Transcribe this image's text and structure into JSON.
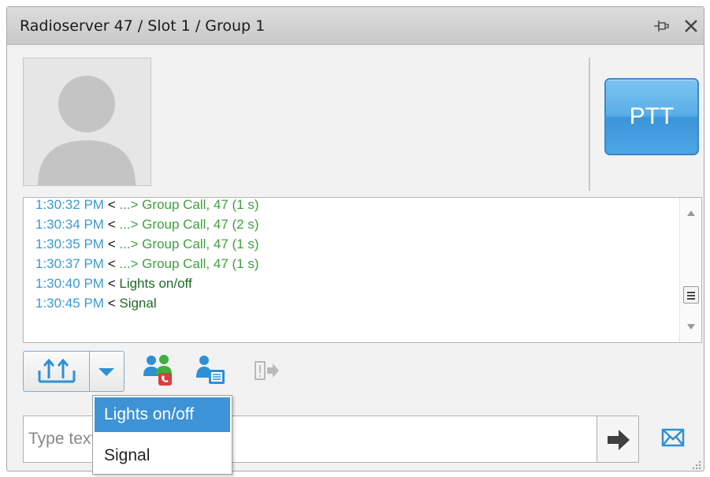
{
  "window": {
    "title": "Radioserver 47 / Slot 1 / Group 1",
    "pin_icon": "pin-icon",
    "close_icon": "close-icon"
  },
  "contact": {
    "avatar_icon": "default-user-avatar",
    "ptt_label": "PTT"
  },
  "log": {
    "entries": [
      {
        "time": "1:30:32 PM",
        "dir": "<",
        "message": "...> Group Call, 47 (1 s)",
        "kind": "call"
      },
      {
        "time": "1:30:34 PM",
        "dir": "<",
        "message": "...> Group Call, 47 (2 s)",
        "kind": "call"
      },
      {
        "time": "1:30:35 PM",
        "dir": "<",
        "message": "...> Group Call, 47 (1 s)",
        "kind": "call"
      },
      {
        "time": "1:30:37 PM",
        "dir": "<",
        "message": "...> Group Call, 47 (1 s)",
        "kind": "call"
      },
      {
        "time": "1:30:40 PM",
        "dir": "<",
        "message": "Lights on/off",
        "kind": "status"
      },
      {
        "time": "1:30:45 PM",
        "dir": "<",
        "message": "Signal",
        "kind": "status"
      }
    ]
  },
  "toolbar": {
    "send_status_icon": "send-status-icon",
    "dropdown_icon": "chevron-down-icon",
    "call_icon": "group-call-icon",
    "phone_icon": "phone-call-icon",
    "remote_icon": "remote-monitor-icon"
  },
  "status_menu": {
    "items": [
      {
        "label": "Lights on/off",
        "selected": true
      },
      {
        "label": "Signal",
        "selected": false
      }
    ]
  },
  "composer": {
    "placeholder": "Type text and press Enter",
    "value": "",
    "send_icon": "arrow-right-icon",
    "mail_icon": "envelope-icon"
  },
  "colors": {
    "timestamp": "#3a9ad6",
    "call_message": "#3fa03f",
    "status_message": "#1d6b25",
    "accent": "#3d93d6",
    "ptt": "#58aee8"
  }
}
